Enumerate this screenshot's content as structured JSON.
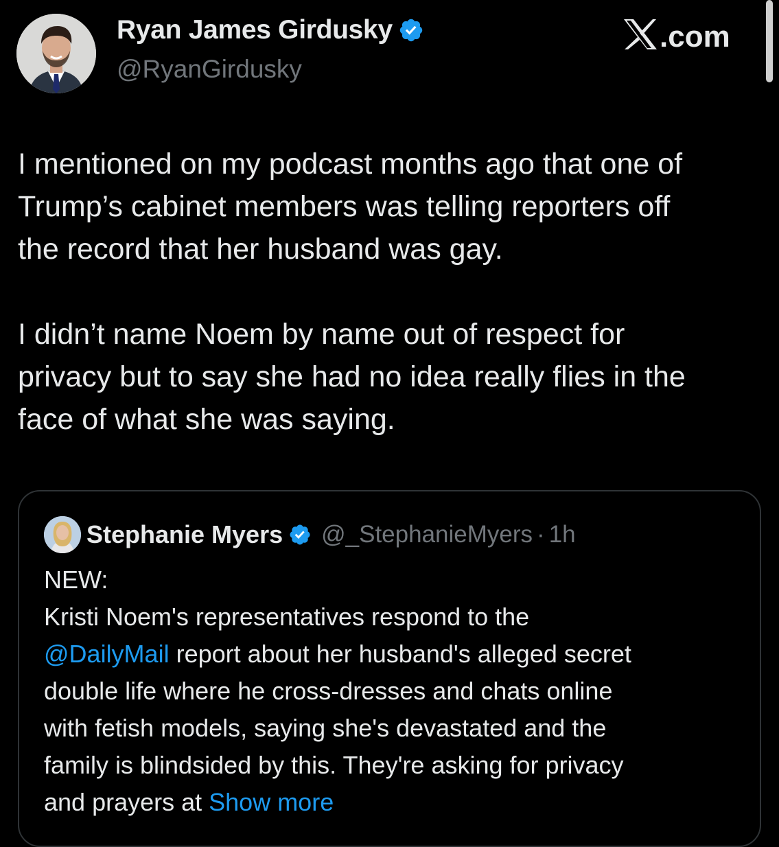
{
  "author": {
    "name": "Ryan James Girdusky",
    "handle": "@RyanGirdusky",
    "verified": true,
    "avatar_icon": "profile-photo"
  },
  "brand": {
    "logo_text": "X.com",
    "icon": "x-logo-icon"
  },
  "tweet": {
    "lines_para1": [
      "I mentioned on my podcast months ago that one of",
      "Trump’s cabinet members was telling reporters off",
      "the record that her husband was gay."
    ],
    "lines_para2": [
      "I didn’t name Noem by name out of respect for",
      "privacy but to say she had no idea really flies in the",
      "face of what she was saying."
    ]
  },
  "quoted_tweet": {
    "name": "Stephanie Myers",
    "handle": "@_StephanieMyers",
    "separator": "·",
    "time": "1h",
    "verified": true,
    "line1": "NEW:",
    "line2": "Kristi Noem's representatives respond to the",
    "mention": "@DailyMail",
    "line3_rest": " report about her husband's alleged secret",
    "line4": "double life where he cross-dresses and chats online",
    "line5": "with fetish models, saying she's devastated and the",
    "line6": "family is blindsided by this. They're asking for privacy",
    "line7_start": "and prayers at ",
    "show_more": "Show more"
  },
  "colors": {
    "background": "#000000",
    "text_primary": "#e7e9ea",
    "text_secondary": "#71767b",
    "link": "#1d9bf0",
    "verified": "#1d9bf0",
    "border": "#2f3336"
  }
}
